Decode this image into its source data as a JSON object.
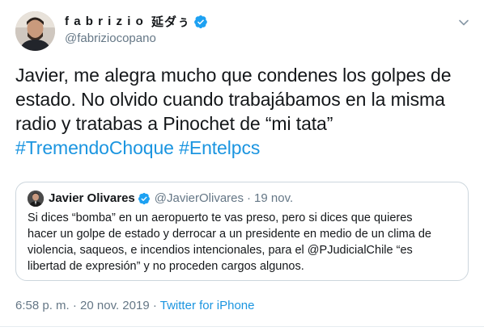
{
  "author": {
    "display_name": "fabrizio",
    "display_suffix": "延ダぅ",
    "handle": "@fabriziocopano",
    "verified": true,
    "avatar_icon": "user-avatar-photo"
  },
  "tweet": {
    "lines": [
      "Javier, me alegra mucho que condenes los golpes de",
      "estado. No olvido cuando trabajábamos en la misma",
      "radio y tratabas a Pinochet de “mi tata”"
    ],
    "hashtags": [
      "#TremendoChoque",
      "#Entelpcs"
    ]
  },
  "quoted": {
    "name": "Javier Olivares",
    "verified": true,
    "handle": "@JavierOlivares",
    "separator": "·",
    "date": "19 nov.",
    "lines": [
      "Si dices “bomba” en un aeropuerto te vas preso, pero si dices que quieres",
      "hacer un golpe de estado y derrocar a un presidente en medio de un clima de",
      "violencia, saqueos, e incendios intencionales, para el @PJudicialChile “es",
      "libertad de expresión” y no proceden cargos algunos."
    ]
  },
  "meta": {
    "time": "6:58 p. m.",
    "separator": "·",
    "date": "20 nov. 2019",
    "source": "Twitter for iPhone"
  },
  "colors": {
    "link": "#1b95e0",
    "secondary": "#657786",
    "border": "#ccd6dd",
    "verified": "#1da1f2"
  },
  "icons": {
    "verified": "verified-badge-icon",
    "caret": "chevron-down-icon"
  }
}
